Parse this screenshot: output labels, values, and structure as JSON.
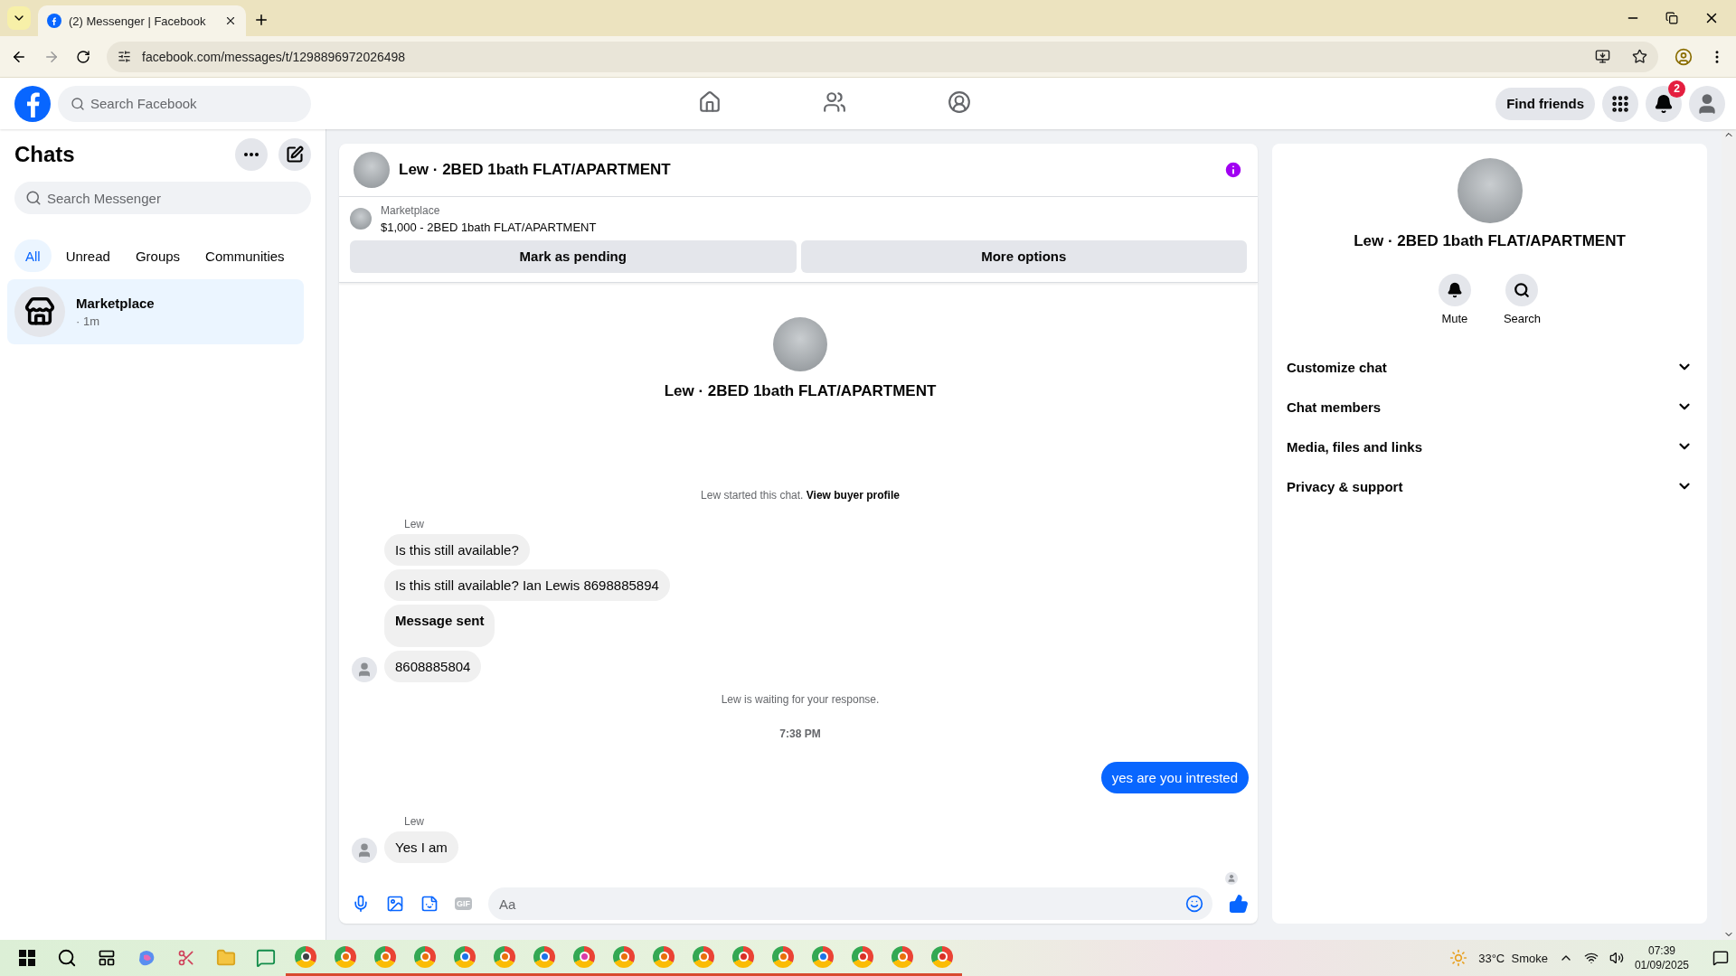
{
  "browser": {
    "tab_title": "(2) Messenger | Facebook",
    "url": "facebook.com/messages/t/1298896972026498"
  },
  "header": {
    "search_placeholder": "Search Facebook",
    "nav": [
      {
        "kind": "home",
        "selected": false
      },
      {
        "kind": "friends",
        "selected": false
      },
      {
        "kind": "groups",
        "selected": false
      }
    ],
    "find_friends": "Find friends",
    "notification_count": "2"
  },
  "sidebar": {
    "title": "Chats",
    "search_placeholder": "Search Messenger",
    "filters": [
      {
        "label": "All",
        "selected": true
      },
      {
        "label": "Unread",
        "selected": false
      },
      {
        "label": "Groups",
        "selected": false
      },
      {
        "label": "Communities",
        "selected": false
      }
    ],
    "chats": [
      {
        "name": "Marketplace",
        "time": "· 1m",
        "selected": true
      }
    ]
  },
  "conversation": {
    "title": "Lew · 2BED 1bath FLAT/APARTMENT",
    "listing": {
      "source": "Marketplace",
      "title": "$1,000 - 2BED 1bath FLAT/APARTMENT"
    },
    "actions": [
      "Mark as pending",
      "More options"
    ],
    "intro_name": "Lew · 2BED 1bath FLAT/APARTMENT",
    "messages": [
      {
        "kind": "system",
        "text": "Lew started this chat.",
        "link": "View buyer profile"
      },
      {
        "kind": "sender",
        "text": "Lew"
      },
      {
        "kind": "incoming",
        "text": "Is this still available?",
        "bold": false,
        "avatar": false
      },
      {
        "kind": "incoming",
        "text": "Is this still available? Ian Lewis 8698885894",
        "bold": false,
        "avatar": false
      },
      {
        "kind": "incoming",
        "text": "Message sent",
        "bold": true,
        "avatar": false
      },
      {
        "kind": "incoming",
        "text": "8608885804",
        "bold": false,
        "avatar": true
      },
      {
        "kind": "system",
        "text": "Lew is waiting for your response."
      },
      {
        "kind": "time",
        "text": "7:38 PM"
      },
      {
        "kind": "outgoing",
        "text": "yes are you intrested"
      },
      {
        "kind": "sender",
        "text": "Lew"
      },
      {
        "kind": "incoming",
        "text": "Yes I am",
        "bold": false,
        "avatar": true
      }
    ],
    "composer_placeholder": "Aa",
    "gif_label": "GIF"
  },
  "details": {
    "name": "Lew · 2BED 1bath FLAT/APARTMENT",
    "actions": [
      {
        "kind": "mute",
        "label": "Mute"
      },
      {
        "kind": "search",
        "label": "Search"
      }
    ],
    "sections": [
      {
        "label": "Customize chat",
        "expanded": false
      },
      {
        "label": "Chat members",
        "expanded": false
      },
      {
        "label": "Media, files and links",
        "expanded": false
      },
      {
        "label": "Privacy & support",
        "expanded": false
      }
    ]
  },
  "taskbar": {
    "apps": [
      {
        "kind": "search"
      },
      {
        "kind": "taskview"
      },
      {
        "kind": "copilot"
      },
      {
        "kind": "snip"
      },
      {
        "kind": "folder"
      },
      {
        "kind": "whatsapp"
      },
      {
        "kind": "browser",
        "color": "#3c4043"
      },
      {
        "kind": "browser",
        "color": "#e8710a"
      },
      {
        "kind": "browser",
        "color": "#e8710a"
      },
      {
        "kind": "browser",
        "color": "#e8710a"
      },
      {
        "kind": "browser",
        "color": "#1a73e8"
      },
      {
        "kind": "browser",
        "color": "#e8710a"
      },
      {
        "kind": "browser",
        "color": "#1a73e8"
      },
      {
        "kind": "browser",
        "color": "#d93aa8"
      },
      {
        "kind": "browser",
        "color": "#e8710a"
      },
      {
        "kind": "browser",
        "color": "#e8710a"
      },
      {
        "kind": "browser",
        "color": "#e8710a"
      },
      {
        "kind": "browser",
        "color": "#d93025"
      },
      {
        "kind": "browser",
        "color": "#e8710a"
      },
      {
        "kind": "browser",
        "color": "#1a73e8"
      },
      {
        "kind": "browser",
        "color": "#d93025"
      },
      {
        "kind": "browser",
        "color": "#e8710a"
      },
      {
        "kind": "browser",
        "color": "#d93025"
      }
    ],
    "weather": {
      "temperature": "33°C",
      "condition": "Smoke"
    },
    "time": "07:39",
    "date": "01/09/2025"
  }
}
